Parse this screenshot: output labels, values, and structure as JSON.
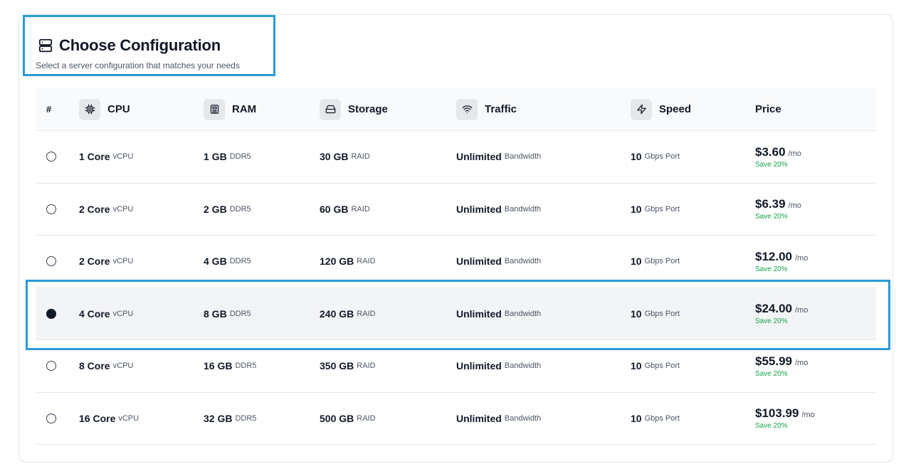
{
  "header": {
    "title": "Choose Configuration",
    "subtitle": "Select a server configuration that matches your needs",
    "icon": "server-icon"
  },
  "columns": {
    "hash": "#",
    "cpu": {
      "label": "CPU",
      "icon": "cpu-icon"
    },
    "ram": {
      "label": "RAM",
      "icon": "memory-icon"
    },
    "storage": {
      "label": "Storage",
      "icon": "hard-drive-icon"
    },
    "traffic": {
      "label": "Traffic",
      "icon": "wifi-icon"
    },
    "speed": {
      "label": "Speed",
      "icon": "lightning-icon"
    },
    "price": {
      "label": "Price"
    }
  },
  "rows": [
    {
      "selected": false,
      "cpu": "1 Core",
      "cpu_unit": "vCPU",
      "ram": "1 GB",
      "ram_unit": "DDR5",
      "storage": "30 GB",
      "storage_unit": "RAID",
      "traffic": "Unlimited",
      "traffic_unit": "Bandwidth",
      "speed": "10",
      "speed_unit": "Gbps Port",
      "price": "$3.60",
      "period": "/mo",
      "save": "Save 20%"
    },
    {
      "selected": false,
      "cpu": "2 Core",
      "cpu_unit": "vCPU",
      "ram": "2 GB",
      "ram_unit": "DDR5",
      "storage": "60 GB",
      "storage_unit": "RAID",
      "traffic": "Unlimited",
      "traffic_unit": "Bandwidth",
      "speed": "10",
      "speed_unit": "Gbps Port",
      "price": "$6.39",
      "period": "/mo",
      "save": "Save 20%"
    },
    {
      "selected": false,
      "cpu": "2 Core",
      "cpu_unit": "vCPU",
      "ram": "4 GB",
      "ram_unit": "DDR5",
      "storage": "120 GB",
      "storage_unit": "RAID",
      "traffic": "Unlimited",
      "traffic_unit": "Bandwidth",
      "speed": "10",
      "speed_unit": "Gbps Port",
      "price": "$12.00",
      "period": "/mo",
      "save": "Save 20%"
    },
    {
      "selected": true,
      "cpu": "4 Core",
      "cpu_unit": "vCPU",
      "ram": "8 GB",
      "ram_unit": "DDR5",
      "storage": "240 GB",
      "storage_unit": "RAID",
      "traffic": "Unlimited",
      "traffic_unit": "Bandwidth",
      "speed": "10",
      "speed_unit": "Gbps Port",
      "price": "$24.00",
      "period": "/mo",
      "save": "Save 20%"
    },
    {
      "selected": false,
      "cpu": "8 Core",
      "cpu_unit": "vCPU",
      "ram": "16 GB",
      "ram_unit": "DDR5",
      "storage": "350 GB",
      "storage_unit": "RAID",
      "traffic": "Unlimited",
      "traffic_unit": "Bandwidth",
      "speed": "10",
      "speed_unit": "Gbps Port",
      "price": "$55.99",
      "period": "/mo",
      "save": "Save 20%"
    },
    {
      "selected": false,
      "cpu": "16 Core",
      "cpu_unit": "vCPU",
      "ram": "32 GB",
      "ram_unit": "DDR5",
      "storage": "500 GB",
      "storage_unit": "RAID",
      "traffic": "Unlimited",
      "traffic_unit": "Bandwidth",
      "speed": "10",
      "speed_unit": "Gbps Port",
      "price": "$103.99",
      "period": "/mo",
      "save": "Save 20%"
    }
  ],
  "colors": {
    "accent_frame": "#2b9ad8",
    "save_text": "#16a34a",
    "selected_row_bg": "#f3f4f6",
    "header_bg": "#f8fafc"
  }
}
